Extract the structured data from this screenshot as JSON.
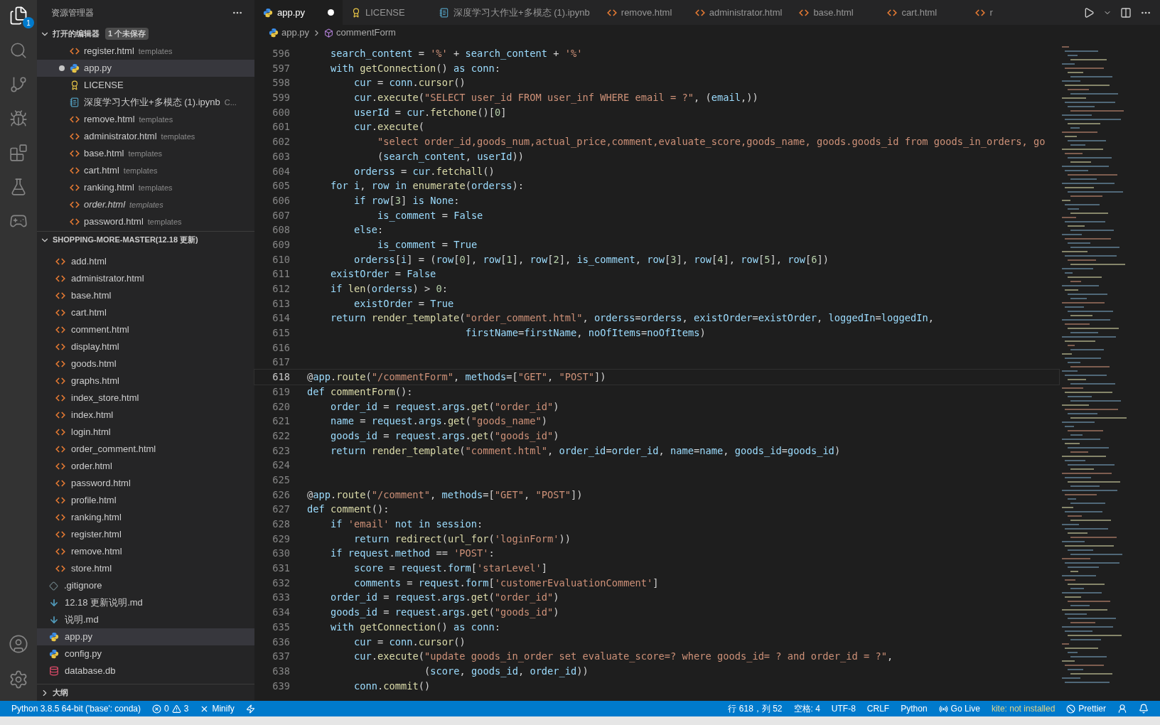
{
  "activity_bar": {
    "explorer_badge": "1"
  },
  "sidebar": {
    "title": "资源管理器",
    "open_editors": {
      "title": "打开的编辑器",
      "badge": "1 个未保存",
      "expanded": true,
      "items": [
        {
          "name": "register.html",
          "description": "templates",
          "kind": "html",
          "modified": false,
          "selected": false,
          "preview": false
        },
        {
          "name": "app.py",
          "kind": "python",
          "modified": true,
          "selected": true,
          "preview": false
        },
        {
          "name": "LICENSE",
          "kind": "license",
          "modified": false,
          "selected": false,
          "preview": false
        },
        {
          "name": "深度学习大作业+多模态 (1).ipynb",
          "description": "C...",
          "kind": "notebook",
          "modified": false,
          "selected": false,
          "preview": false
        },
        {
          "name": "remove.html",
          "description": "templates",
          "kind": "html",
          "modified": false,
          "selected": false,
          "preview": false
        },
        {
          "name": "administrator.html",
          "description": "templates",
          "kind": "html",
          "modified": false,
          "selected": false,
          "preview": false
        },
        {
          "name": "base.html",
          "description": "templates",
          "kind": "html",
          "modified": false,
          "selected": false,
          "preview": false
        },
        {
          "name": "cart.html",
          "description": "templates",
          "kind": "html",
          "modified": false,
          "selected": false,
          "preview": false
        },
        {
          "name": "ranking.html",
          "description": "templates",
          "kind": "html",
          "modified": false,
          "selected": false,
          "preview": false
        },
        {
          "name": "order.html",
          "description": "templates",
          "kind": "html",
          "modified": false,
          "selected": false,
          "preview": true
        },
        {
          "name": "password.html",
          "description": "templates",
          "kind": "html",
          "modified": false,
          "selected": false,
          "preview": false
        }
      ]
    },
    "project": {
      "title": "SHOPPING-MORE-MASTER(12.18 更新)",
      "expanded": true,
      "templates_files": [
        {
          "name": "add.html",
          "kind": "html",
          "selected": false
        },
        {
          "name": "administrator.html",
          "kind": "html",
          "selected": false
        },
        {
          "name": "base.html",
          "kind": "html",
          "selected": false
        },
        {
          "name": "cart.html",
          "kind": "html",
          "selected": false
        },
        {
          "name": "comment.html",
          "kind": "html",
          "selected": false
        },
        {
          "name": "display.html",
          "kind": "html",
          "selected": false
        },
        {
          "name": "goods.html",
          "kind": "html",
          "selected": false
        },
        {
          "name": "graphs.html",
          "kind": "html",
          "selected": false
        },
        {
          "name": "index_store.html",
          "kind": "html",
          "selected": false
        },
        {
          "name": "index.html",
          "kind": "html",
          "selected": false
        },
        {
          "name": "login.html",
          "kind": "html",
          "selected": false
        },
        {
          "name": "order_comment.html",
          "kind": "html",
          "selected": false
        },
        {
          "name": "order.html",
          "kind": "html",
          "selected": false
        },
        {
          "name": "password.html",
          "kind": "html",
          "selected": false
        },
        {
          "name": "profile.html",
          "kind": "html",
          "selected": false
        },
        {
          "name": "ranking.html",
          "kind": "html",
          "selected": false
        },
        {
          "name": "register.html",
          "kind": "html",
          "selected": false
        },
        {
          "name": "remove.html",
          "kind": "html",
          "selected": false
        },
        {
          "name": "store.html",
          "kind": "html",
          "selected": false
        }
      ],
      "root_files": [
        {
          "name": ".gitignore",
          "kind": "git",
          "selected": false
        },
        {
          "name": "12.18 更新说明.md",
          "kind": "markdown",
          "selected": false
        },
        {
          "name": "说明.md",
          "kind": "markdown",
          "selected": false
        },
        {
          "name": "app.py",
          "kind": "python",
          "selected": true
        },
        {
          "name": "config.py",
          "kind": "python",
          "selected": false
        },
        {
          "name": "database.db",
          "kind": "database",
          "selected": false
        }
      ]
    },
    "outline": {
      "title": "大纲",
      "expanded": false
    }
  },
  "tabs": [
    {
      "label": "app.py",
      "kind": "python",
      "selected": true,
      "modified": true
    },
    {
      "label": "LICENSE",
      "kind": "license",
      "selected": false,
      "modified": false
    },
    {
      "label": "深度学习大作业+多模态 (1).ipynb",
      "kind": "notebook",
      "selected": false,
      "modified": false
    },
    {
      "label": "remove.html",
      "kind": "html",
      "selected": false,
      "modified": false
    },
    {
      "label": "administrator.html",
      "kind": "html",
      "selected": false,
      "modified": false
    },
    {
      "label": "base.html",
      "kind": "html",
      "selected": false,
      "modified": false
    },
    {
      "label": "cart.html",
      "kind": "html",
      "selected": false,
      "modified": false
    },
    {
      "label": "r",
      "kind": "html",
      "selected": false,
      "modified": false
    }
  ],
  "breadcrumbs": [
    {
      "label": "app.py",
      "kind": "file"
    },
    {
      "label": "commentForm",
      "kind": "method"
    }
  ],
  "editor": {
    "lines": [
      {
        "number": "596",
        "text": "    search_content = '%' + search_content + '%'",
        "current": false
      },
      {
        "number": "597",
        "text": "    with getConnection() as conn:",
        "current": false
      },
      {
        "number": "598",
        "text": "        cur = conn.cursor()",
        "current": false
      },
      {
        "number": "599",
        "text": "        cur.execute(\"SELECT user_id FROM user_inf WHERE email = ?\", (email,))",
        "current": false
      },
      {
        "number": "600",
        "text": "        userId = cur.fetchone()[0]",
        "current": false
      },
      {
        "number": "601",
        "text": "        cur.execute(",
        "current": false
      },
      {
        "number": "602",
        "text": "            \"select order_id,goods_num,actual_price,comment,evaluate_score,goods_name, goods.goods_id from goods_in_orders, go",
        "current": false
      },
      {
        "number": "603",
        "text": "            (search_content, userId))",
        "current": false
      },
      {
        "number": "604",
        "text": "        orderss = cur.fetchall()",
        "current": false
      },
      {
        "number": "605",
        "text": "    for i, row in enumerate(orderss):",
        "current": false
      },
      {
        "number": "606",
        "text": "        if row[3] is None:",
        "current": false
      },
      {
        "number": "607",
        "text": "            is_comment = False",
        "current": false
      },
      {
        "number": "608",
        "text": "        else:",
        "current": false
      },
      {
        "number": "609",
        "text": "            is_comment = True",
        "current": false
      },
      {
        "number": "610",
        "text": "        orderss[i] = (row[0], row[1], row[2], is_comment, row[3], row[4], row[5], row[6])",
        "current": false
      },
      {
        "number": "611",
        "text": "    existOrder = False",
        "current": false
      },
      {
        "number": "612",
        "text": "    if len(orderss) > 0:",
        "current": false
      },
      {
        "number": "613",
        "text": "        existOrder = True",
        "current": false
      },
      {
        "number": "614",
        "text": "    return render_template(\"order_comment.html\", orderss=orderss, existOrder=existOrder, loggedIn=loggedIn,",
        "current": false
      },
      {
        "number": "615",
        "text": "                           firstName=firstName, noOfItems=noOfItems)",
        "current": false
      },
      {
        "number": "616",
        "current": false
      },
      {
        "number": "617",
        "current": false
      },
      {
        "number": "618",
        "text": "@app.route(\"/commentForm\", methods=[\"GET\", \"POST\"])",
        "current": true
      },
      {
        "number": "619",
        "text": "def commentForm():",
        "current": false
      },
      {
        "number": "620",
        "text": "    order_id = request.args.get(\"order_id\")",
        "current": false
      },
      {
        "number": "621",
        "text": "    name = request.args.get(\"goods_name\")",
        "current": false
      },
      {
        "number": "622",
        "text": "    goods_id = request.args.get(\"goods_id\")",
        "current": false
      },
      {
        "number": "623",
        "text": "    return render_template(\"comment.html\", order_id=order_id, name=name, goods_id=goods_id)",
        "current": false
      },
      {
        "number": "624",
        "current": false
      },
      {
        "number": "625",
        "current": false
      },
      {
        "number": "626",
        "text": "@app.route(\"/comment\", methods=[\"GET\", \"POST\"])",
        "current": false
      },
      {
        "number": "627",
        "text": "def comment():",
        "current": false
      },
      {
        "number": "628",
        "text": "    if 'email' not in session:",
        "current": false
      },
      {
        "number": "629",
        "text": "        return redirect(url_for('loginForm'))",
        "current": false
      },
      {
        "number": "630",
        "text": "    if request.method == 'POST':",
        "current": false
      },
      {
        "number": "631",
        "text": "        score = request.form['starLevel']",
        "current": false
      },
      {
        "number": "632",
        "text": "        comments = request.form['customerEvaluationComment']",
        "current": false
      },
      {
        "number": "633",
        "text": "    order_id = request.args.get(\"order_id\")",
        "current": false
      },
      {
        "number": "634",
        "text": "    goods_id = request.args.get(\"goods_id\")",
        "current": false
      },
      {
        "number": "635",
        "text": "    with getConnection() as conn:",
        "current": false
      },
      {
        "number": "636",
        "text": "        cur = conn.cursor()",
        "current": false
      },
      {
        "number": "637",
        "text": "        cur.execute(\"update goods_in_order set evaluate_score=? where goods_id= ? and order_id = ?\",",
        "current": false
      },
      {
        "number": "638",
        "text": "                    (score, goods_id, order_id))",
        "current": false
      },
      {
        "number": "639",
        "text": "        conn.commit()",
        "current": false
      }
    ]
  },
  "status_bar": {
    "left": [
      {
        "kind": "interpreter",
        "text": "Python 3.8.5 64-bit ('base': conda)"
      },
      {
        "kind": "problems",
        "errors": "0",
        "warnings": "3"
      },
      {
        "kind": "minify",
        "text": "Minify"
      },
      {
        "kind": "lightning"
      }
    ],
    "right": [
      {
        "kind": "text",
        "text": "行 618，列 52"
      },
      {
        "kind": "text",
        "text": "空格: 4"
      },
      {
        "kind": "text",
        "text": "UTF-8"
      },
      {
        "kind": "text",
        "text": "CRLF"
      },
      {
        "kind": "text",
        "text": "Python"
      },
      {
        "kind": "golive",
        "text": "Go Live"
      },
      {
        "kind": "kite",
        "text": "kite: not installed"
      },
      {
        "kind": "prettier",
        "text": "Prettier"
      },
      {
        "kind": "feedback"
      },
      {
        "kind": "bell"
      }
    ]
  }
}
